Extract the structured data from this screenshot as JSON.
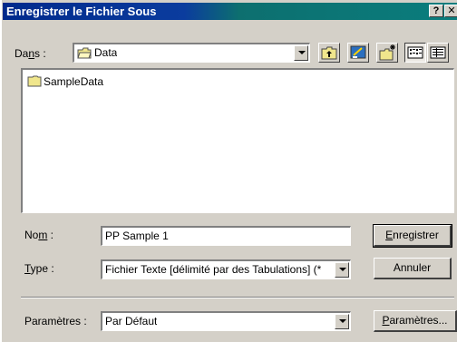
{
  "window": {
    "title": "Enregistrer le Fichier Sous",
    "help_button": "?",
    "close_button": "✕"
  },
  "location": {
    "label_pre": "Da",
    "label_accel": "n",
    "label_post": "s :",
    "value": "Data",
    "folder_icon": "folder-open-icon"
  },
  "toolbar": {
    "items": [
      "up-folder-icon",
      "desktop-icon",
      "new-folder-icon",
      "list-view-icon",
      "details-view-icon"
    ]
  },
  "file_list": {
    "items": [
      {
        "name": "SampleData",
        "icon": "folder-icon"
      }
    ]
  },
  "filename": {
    "label_pre": "No",
    "label_accel": "m",
    "label_post": " :",
    "value": "PP Sample 1"
  },
  "filetype": {
    "label_accel": "T",
    "label_post": "ype :",
    "value": "Fichier Texte [délimité par des Tabulations] (*"
  },
  "parameters": {
    "label": "Paramètres :",
    "value": "Par Défaut",
    "button_accel": "P",
    "button_rest": "aramètres..."
  },
  "buttons": {
    "save_accel": "E",
    "save_rest": "nregistrer",
    "cancel": "Annuler"
  },
  "colors": {
    "title_start": "#002a8c",
    "title_end": "#0a7d7d",
    "face": "#d4d0c8",
    "folder": "#f0e68c"
  }
}
